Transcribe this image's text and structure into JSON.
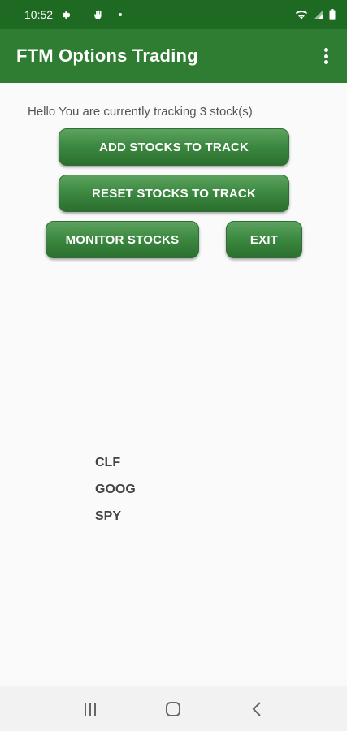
{
  "status_bar": {
    "time": "10:52",
    "icons": [
      "settings-gear-icon",
      "hand-icon",
      "dot-icon",
      "wifi-icon",
      "signal-icon",
      "battery-icon"
    ]
  },
  "app_bar": {
    "title": "FTM Options Trading",
    "menu_icon": "overflow-menu-icon"
  },
  "main": {
    "greeting": "Hello You are currently tracking 3 stock(s)",
    "buttons": {
      "add": "ADD STOCKS TO TRACK",
      "reset": "RESET STOCKS TO TRACK",
      "monitor": "MONITOR STOCKS",
      "exit": "EXIT"
    },
    "stocks": [
      "CLF",
      "GOOG",
      "SPY"
    ]
  },
  "nav_bar": {
    "icons": [
      "recent-apps-icon",
      "home-icon",
      "back-icon"
    ]
  },
  "colors": {
    "status_bar": "#1e6a22",
    "app_bar": "#2e7d32",
    "button": "#3e8a42",
    "background": "#fafafa"
  }
}
